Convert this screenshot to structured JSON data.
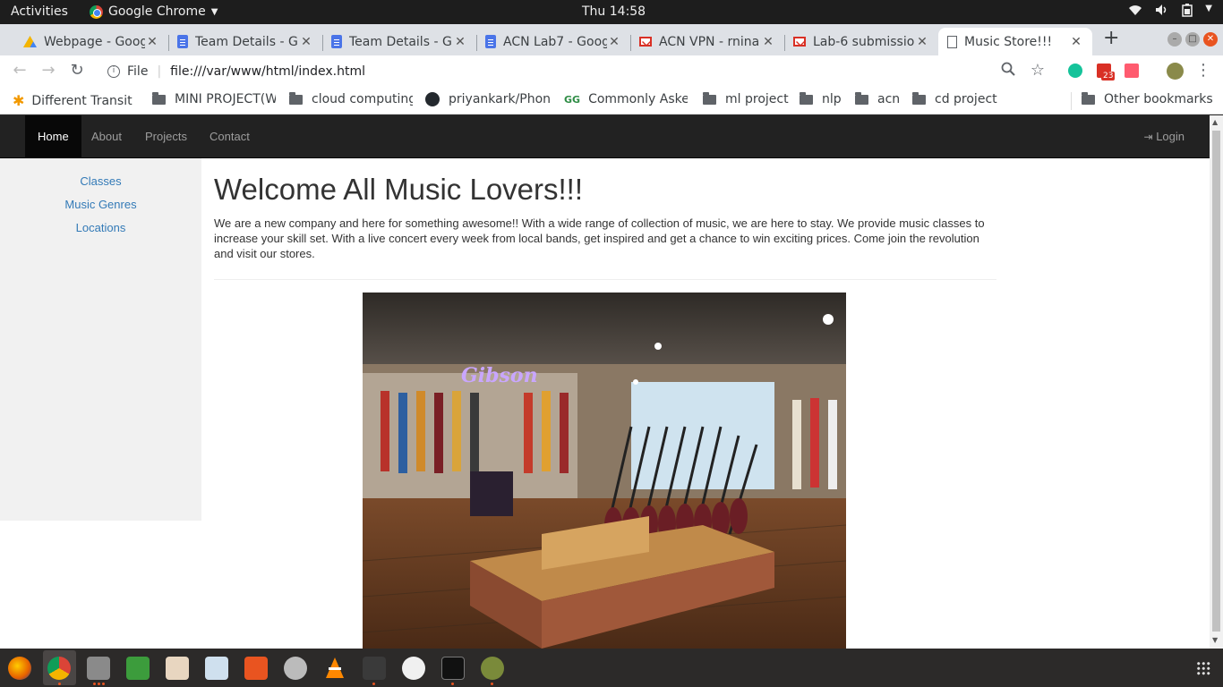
{
  "topbar": {
    "activities": "Activities",
    "app_name": "Google Chrome",
    "clock": "Thu 14:58"
  },
  "tabs": [
    {
      "label": "Webpage - Goog",
      "icon": "drive-icon"
    },
    {
      "label": "Team Details - G",
      "icon": "docs-icon"
    },
    {
      "label": "Team Details - G",
      "icon": "docs-icon"
    },
    {
      "label": "ACN Lab7 - Goog",
      "icon": "docs-icon"
    },
    {
      "label": "ACN VPN - rnina",
      "icon": "gmail-icon"
    },
    {
      "label": "Lab-6 submissio",
      "icon": "gmail-icon"
    },
    {
      "label": "Music Store!!!",
      "icon": "page-icon",
      "active": true
    }
  ],
  "toolbar": {
    "scheme": "File",
    "url": "file:///var/www/html/index.html",
    "gmail_badge": "23"
  },
  "bookmarks": {
    "items": [
      {
        "label": "Different Transit",
        "icon": "star-bookmark-icon"
      },
      {
        "label": "MINI PROJECT(W",
        "icon": "folder-icon"
      },
      {
        "label": "cloud computing",
        "icon": "folder-icon"
      },
      {
        "label": "priyankark/Phon",
        "icon": "github-icon"
      },
      {
        "label": "Commonly Aske",
        "icon": "gfg-icon"
      },
      {
        "label": "ml project",
        "icon": "folder-icon"
      },
      {
        "label": "nlp",
        "icon": "folder-icon"
      },
      {
        "label": "acn",
        "icon": "folder-icon"
      },
      {
        "label": "cd project",
        "icon": "folder-icon"
      }
    ],
    "other": "Other bookmarks"
  },
  "page": {
    "nav": {
      "items": [
        "Home",
        "About",
        "Projects",
        "Contact"
      ],
      "login": "Login"
    },
    "sidebar": {
      "links": [
        "Classes",
        "Music Genres",
        "Locations"
      ]
    },
    "heading": "Welcome All Music Lovers!!!",
    "intro": "We are a new company and here for something awesome!! With a wide range of collection of music, we are here to stay. We provide music classes to increase your skill set. With a live concert every week from local bands, get inspired and get a chance to win exciting prices. Come join the revolution and visit our stores.",
    "image_sign": "Gibson"
  },
  "colors": {
    "navbar_bg": "#222222",
    "link": "#337ab7",
    "sidebar_bg": "#f1f1f1"
  }
}
